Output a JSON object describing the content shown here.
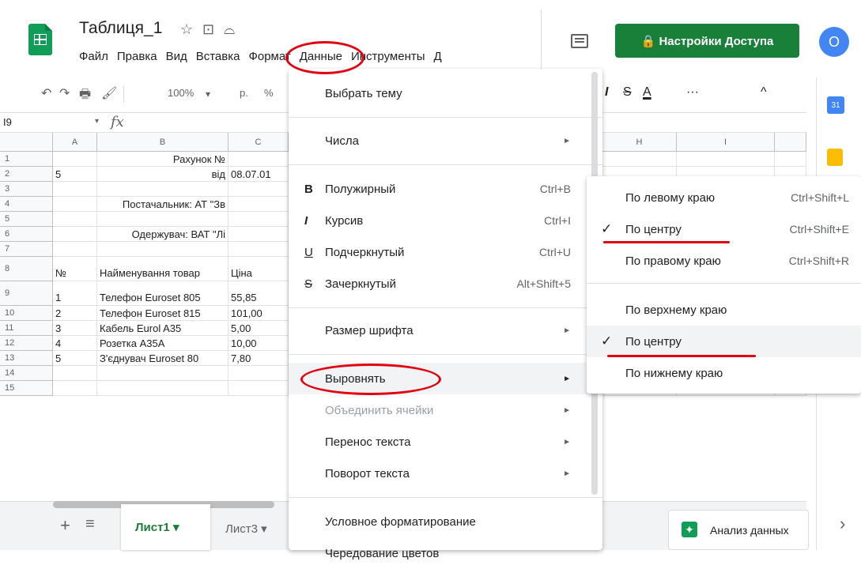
{
  "header": {
    "title": "Таблиця_1",
    "star": "☆",
    "folder": "⊡",
    "cloud": "⌓",
    "menus": [
      "Файл",
      "Правка",
      "Вид",
      "Вставка",
      "Формат",
      "Данные",
      "Инструменты",
      "Д"
    ],
    "share_label": "🔒 Настройки Доступа",
    "avatar_letter": "O"
  },
  "toolbar": {
    "undo": "↶",
    "redo": "↷",
    "print": "🖶",
    "paint": "🖌",
    "zoom": "100%",
    "zoom_caret": "▾",
    "currency": "р.",
    "percent": "%",
    "italic": "I",
    "strike": "S",
    "textcolor": "A",
    "more": "···",
    "collapse": "^"
  },
  "formula": {
    "cell_ref": "I9",
    "fx": "fx"
  },
  "columns": [
    "A",
    "B",
    "C",
    "H",
    "I"
  ],
  "rows": [
    {
      "n": "1",
      "cells": {
        "B": "Рахунок №"
      }
    },
    {
      "n": "2",
      "cells": {
        "A": "5",
        "B": "від",
        "C": "08.07.01"
      }
    },
    {
      "n": "3",
      "cells": {}
    },
    {
      "n": "4",
      "cells": {
        "B": "Постачальник: АТ \"Зв"
      }
    },
    {
      "n": "5",
      "cells": {}
    },
    {
      "n": "6",
      "cells": {
        "B": "Одержувач: ВАТ \"Лі"
      }
    },
    {
      "n": "7",
      "cells": {}
    },
    {
      "n": "8",
      "cells": {
        "A": "№",
        "B": "Найменування товар",
        "C": "Ціна"
      }
    },
    {
      "n": "9",
      "cells": {
        "A": "1",
        "B": "Телефон Euroset 805",
        "C": "55,85"
      }
    },
    {
      "n": "10",
      "cells": {
        "A": "2",
        "B": "Телефон Euroset 815",
        "C": "101,00"
      }
    },
    {
      "n": "11",
      "cells": {
        "A": "3",
        "B": "Кабель  Eurol A35",
        "C": "5,00"
      }
    },
    {
      "n": "12",
      "cells": {
        "A": "4",
        "B": "Розетка A35A",
        "C": "10,00"
      }
    },
    {
      "n": "13",
      "cells": {
        "A": "5",
        "B": "З'єднувач Euroset 80",
        "C": "7,80"
      }
    },
    {
      "n": "14",
      "cells": {}
    },
    {
      "n": "15",
      "cells": {}
    }
  ],
  "format_menu": {
    "choose_theme": "Выбрать тему",
    "numbers": "Числа",
    "bold": {
      "icon": "B",
      "label": "Полужирный",
      "shortcut": "Ctrl+B"
    },
    "italic": {
      "icon": "I",
      "label": "Курсив",
      "shortcut": "Ctrl+I"
    },
    "underline": {
      "icon": "U",
      "label": "Подчеркнутый",
      "shortcut": "Ctrl+U"
    },
    "strike": {
      "icon": "S",
      "label": "Зачеркнутый",
      "shortcut": "Alt+Shift+5"
    },
    "font_size": "Размер шрифта",
    "align": "Выровнять",
    "merge": "Объединить ячейки",
    "wrap": "Перенос текста",
    "rotate": "Поворот текста",
    "conditional": "Условное форматирование",
    "alternating": "Чередование цветов",
    "arrow": "►"
  },
  "align_menu": {
    "left": {
      "label": "По левому краю",
      "shortcut": "Ctrl+Shift+L"
    },
    "center": {
      "label": "По центру",
      "shortcut": "Ctrl+Shift+E",
      "check": "✓"
    },
    "right": {
      "label": "По правому краю",
      "shortcut": "Ctrl+Shift+R"
    },
    "top": {
      "label": "По верхнему краю"
    },
    "middle": {
      "label": "По центру",
      "check": "✓"
    },
    "bottom": {
      "label": "По нижнему краю"
    }
  },
  "bottom": {
    "add": "+",
    "list": "≡",
    "sheet1": "Лист1 ▾",
    "sheet3": "Лист3 ▾",
    "explore": "Анализ данных",
    "next": "›"
  },
  "side": {
    "calendar": "31"
  }
}
